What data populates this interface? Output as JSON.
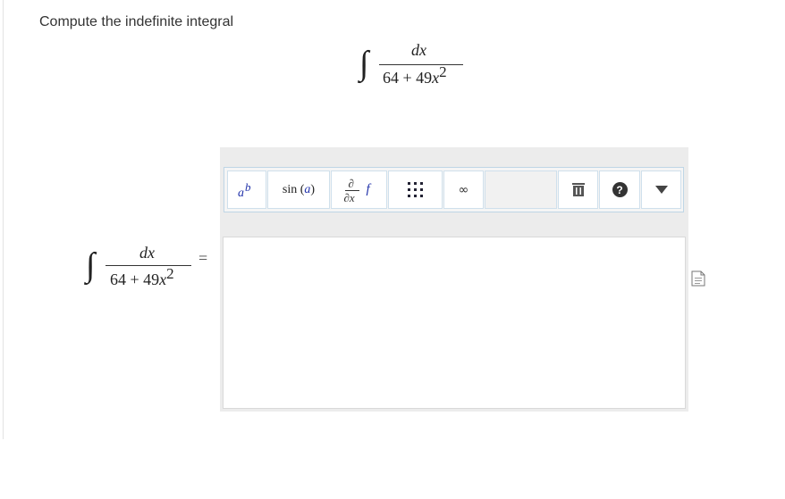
{
  "question": {
    "prompt": "Compute the indefinite integral"
  },
  "integral": {
    "sign": "∫",
    "numerator": "dx",
    "denominator_const": "64 + 49",
    "denominator_var": "x",
    "denominator_exp": "2"
  },
  "answer_row": {
    "equals": "="
  },
  "toolbar": {
    "buttons": [
      {
        "name": "power",
        "icon": "power-icon",
        "base": "a",
        "exp": "b"
      },
      {
        "name": "function",
        "icon": "sin-function-icon",
        "text": "sin",
        "arg": "a"
      },
      {
        "name": "derivative",
        "icon": "partial-derivative-icon",
        "num": "∂",
        "den": "∂x",
        "fn": "f"
      },
      {
        "name": "matrix",
        "icon": "matrix-grid-icon"
      },
      {
        "name": "infinity",
        "icon": "infinity-icon",
        "text": "∞"
      },
      {
        "name": "delete",
        "icon": "trash-icon"
      },
      {
        "name": "help",
        "icon": "help-icon",
        "text": "?"
      },
      {
        "name": "more",
        "icon": "caret-down-icon"
      }
    ]
  },
  "answer_input": {
    "value": ""
  },
  "side_icon": {
    "icon": "document-icon"
  }
}
